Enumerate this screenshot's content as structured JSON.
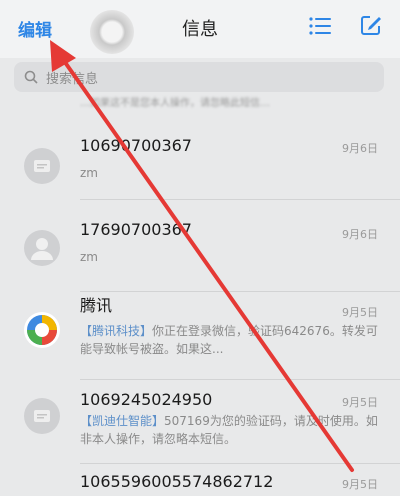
{
  "header": {
    "edit_label": "编辑",
    "title": "信息",
    "menu_icon": "list-icon",
    "compose_icon": "compose-icon"
  },
  "search": {
    "placeholder": "搜索信息"
  },
  "peek_text": "…如果这不是您本人操作，请忽略此短信…",
  "messages": [
    {
      "sender": "10690700367",
      "date": "9月6日",
      "preview": "zm"
    },
    {
      "sender": "17690700367",
      "date": "9月6日",
      "preview": "zm"
    },
    {
      "sender": "腾讯",
      "date": "9月5日",
      "tag": "【腾讯科技】",
      "preview": "你正在登录微信，验证码642676。转发可能导致帐号被盗。如果这..."
    },
    {
      "sender": "1069245024950",
      "date": "9月5日",
      "tag": "【凯迪仕智能】",
      "preview": "507169为您的验证码，请及时使用。如非本人操作，请忽略本短信。"
    },
    {
      "sender": "10655960055748627​12",
      "date": "9月5日",
      "preview": ""
    }
  ],
  "colors": {
    "accent": "#2e86e6",
    "annotation_arrow": "#e53935"
  }
}
